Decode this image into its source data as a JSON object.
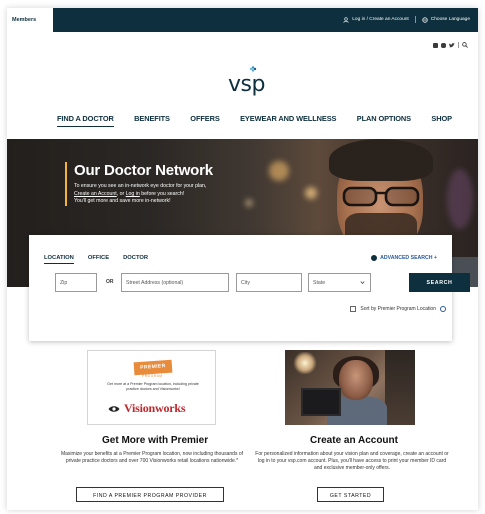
{
  "utility_bar": {
    "members_label": "Members",
    "login_label": "Log in / Create an Account",
    "language_label": "Choose Language"
  },
  "brand": {
    "logo_text": "vsp"
  },
  "nav": {
    "items": [
      "FIND A DOCTOR",
      "BENEFITS",
      "OFFERS",
      "EYEWEAR AND WELLNESS",
      "PLAN OPTIONS",
      "SHOP"
    ],
    "active_index": 0
  },
  "hero": {
    "title": "Our Doctor Network",
    "line1": "To ensure you see an in-network eye doctor for your plan,",
    "link_create": "Create an Account",
    "line2_mid": ", or",
    "link_login": "Log in",
    "line2_end": "before you search!",
    "line3": "You'll get more and save more in-network!"
  },
  "search": {
    "tabs": [
      "LOCATION",
      "OFFICE",
      "DOCTOR"
    ],
    "active_tab": 0,
    "advanced_label": "ADVANCED SEARCH +",
    "zip_placeholder": "Zip",
    "or_label": "OR",
    "street_placeholder": "Street Address (optional)",
    "city_placeholder": "City",
    "state_value": "State",
    "search_button": "SEARCH",
    "sort_label": "Sort by Premier Program Location"
  },
  "premier_card": {
    "badge_text": "PREMIER",
    "badge_sub": "PROGRAM",
    "fine_print": "Get more at a Premier Program location, including private practice doctors and Visionworks!",
    "brand_name": "Visionworks",
    "title": "Get More with Premier",
    "body": "Maximize your benefits at a Premier Program location, now including thousands of private practice doctors and over 700 Visionworks retail locations nationwide.*",
    "button": "FIND A PREMIER PROGRAM PROVIDER"
  },
  "account_card": {
    "title": "Create an Account",
    "body": "For personalized information about your vision plan and coverage, create an account or log in to your vsp.com account. Plus, you'll have access to print your member ID card and exclusive member-only offers.",
    "button": "GET STARTED"
  },
  "colors": {
    "navy": "#0d2f3e",
    "accent_gold": "#f2b43a",
    "link_blue": "#2a5a9c",
    "visionworks_red": "#c0272d",
    "premier_orange": "#e88c3c"
  },
  "icons": [
    "user-icon",
    "globe-icon",
    "facebook-icon",
    "instagram-icon",
    "twitter-icon",
    "search-icon",
    "info-icon",
    "chevron-down-icon"
  ]
}
